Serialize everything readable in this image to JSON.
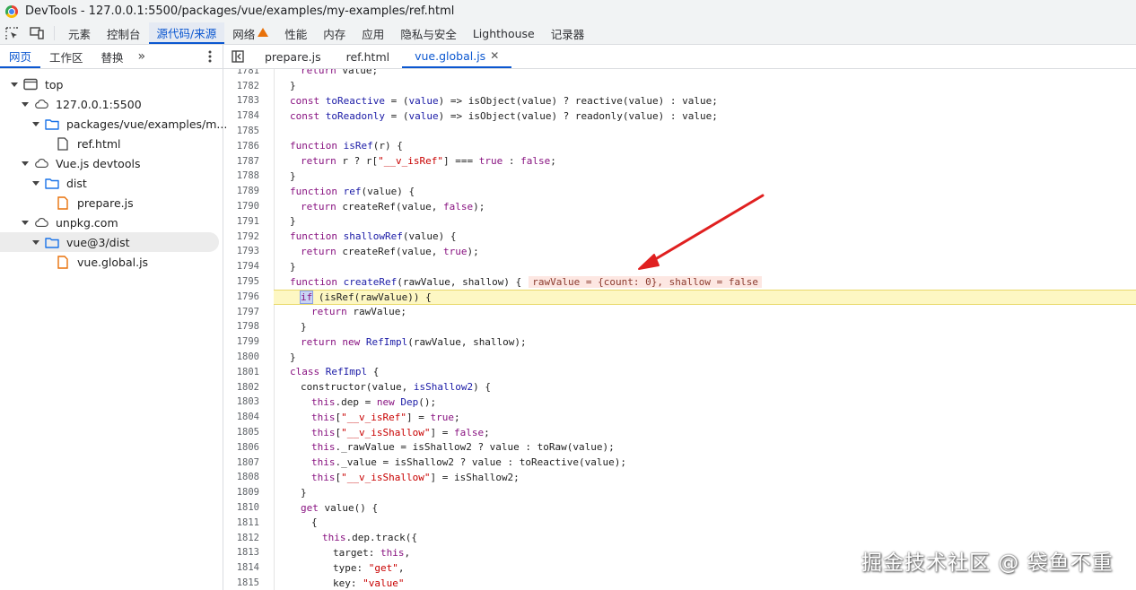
{
  "window": {
    "title": "DevTools - 127.0.0.1:5500/packages/vue/examples/my-examples/ref.html"
  },
  "main_tabs": [
    {
      "label": "元素"
    },
    {
      "label": "控制台"
    },
    {
      "label": "源代码/来源",
      "active": true
    },
    {
      "label": "网络",
      "warning": true
    },
    {
      "label": "性能"
    },
    {
      "label": "内存"
    },
    {
      "label": "应用"
    },
    {
      "label": "隐私与安全"
    },
    {
      "label": "Lighthouse"
    },
    {
      "label": "记录器"
    }
  ],
  "sidebar": {
    "tabs": [
      {
        "label": "网页",
        "active": true
      },
      {
        "label": "工作区"
      },
      {
        "label": "替换"
      }
    ],
    "more": "»",
    "tree": [
      {
        "label": "top",
        "icon": "frame-icon",
        "depth": 0,
        "caret": true
      },
      {
        "label": "127.0.0.1:5500",
        "icon": "cloud-icon",
        "depth": 1,
        "caret": true
      },
      {
        "label": "packages/vue/examples/m...",
        "icon": "folder-icon",
        "depth": 2,
        "caret": true
      },
      {
        "label": "ref.html",
        "icon": "file-icon",
        "depth": 3,
        "caret": false
      },
      {
        "label": "Vue.js devtools",
        "icon": "cloud-icon",
        "depth": 1,
        "caret": true
      },
      {
        "label": "dist",
        "icon": "folder-icon",
        "depth": 2,
        "caret": true
      },
      {
        "label": "prepare.js",
        "icon": "js-file-icon",
        "depth": 3,
        "caret": false
      },
      {
        "label": "unpkg.com",
        "icon": "cloud-icon",
        "depth": 1,
        "caret": true
      },
      {
        "label": "vue@3/dist",
        "icon": "folder-icon",
        "depth": 2,
        "caret": true,
        "selected": true
      },
      {
        "label": "vue.global.js",
        "icon": "js-file-icon",
        "depth": 3,
        "caret": false
      }
    ]
  },
  "editor": {
    "tabs": [
      {
        "label": "prepare.js"
      },
      {
        "label": "ref.html"
      },
      {
        "label": "vue.global.js",
        "active": true,
        "closable": true
      }
    ],
    "highlight_line": 1796,
    "lines": [
      {
        "n": "1781",
        "indent": 1,
        "html": "<span class='tk-kw'>return</span> value;"
      },
      {
        "n": "1782",
        "indent": 0,
        "html": "}"
      },
      {
        "n": "1783",
        "indent": 0,
        "html": "<span class='tk-kw'>const</span> <span class='tk-fn'>toReactive</span> = (<span class='tk-fn'>value</span>) => isObject(value) ? reactive(value) : value;"
      },
      {
        "n": "1784",
        "indent": 0,
        "html": "<span class='tk-kw'>const</span> <span class='tk-fn'>toReadonly</span> = (<span class='tk-fn'>value</span>) => isObject(value) ? readonly(value) : value;"
      },
      {
        "n": "1785",
        "indent": 0,
        "html": ""
      },
      {
        "n": "1786",
        "indent": 0,
        "html": "<span class='tk-kw'>function</span> <span class='tk-fn'>isRef</span>(r) {"
      },
      {
        "n": "1787",
        "indent": 1,
        "html": "<span class='tk-kw'>return</span> r ? r[<span class='tk-str'>\"__v_isRef\"</span>] === <span class='tk-kw'>true</span> : <span class='tk-kw'>false</span>;"
      },
      {
        "n": "1788",
        "indent": 0,
        "html": "}"
      },
      {
        "n": "1789",
        "indent": 0,
        "html": "<span class='tk-kw'>function</span> <span class='tk-fn'>ref</span>(value) {"
      },
      {
        "n": "1790",
        "indent": 1,
        "html": "<span class='tk-kw'>return</span> createRef(value, <span class='tk-kw'>false</span>);"
      },
      {
        "n": "1791",
        "indent": 0,
        "html": "}"
      },
      {
        "n": "1792",
        "indent": 0,
        "html": "<span class='tk-kw'>function</span> <span class='tk-fn'>shallowRef</span>(value) {"
      },
      {
        "n": "1793",
        "indent": 1,
        "html": "<span class='tk-kw'>return</span> createRef(value, <span class='tk-kw'>true</span>);"
      },
      {
        "n": "1794",
        "indent": 0,
        "html": "}"
      },
      {
        "n": "1795",
        "indent": 0,
        "html": "<span class='tk-kw'>function</span> <span class='tk-fn'>createRef</span>(rawValue, shallow) {<span class='inline-val'>rawValue = {count: 0}, shallow = false</span>"
      },
      {
        "n": "1796",
        "indent": 1,
        "html": "<span class='tk-kw ifmark'>if</span> (isRef(rawValue)) {"
      },
      {
        "n": "1797",
        "indent": 2,
        "html": "<span class='tk-kw'>return</span> rawValue;"
      },
      {
        "n": "1798",
        "indent": 1,
        "html": "}"
      },
      {
        "n": "1799",
        "indent": 1,
        "html": "<span class='tk-kw'>return new</span> <span class='tk-fn'>RefImpl</span>(rawValue, shallow);"
      },
      {
        "n": "1800",
        "indent": 0,
        "html": "}"
      },
      {
        "n": "1801",
        "indent": 0,
        "html": "<span class='tk-kw'>class</span> <span class='tk-fn'>RefImpl</span> {"
      },
      {
        "n": "1802",
        "indent": 1,
        "html": "constructor(value, <span class='tk-fn'>isShallow2</span>) {"
      },
      {
        "n": "1803",
        "indent": 2,
        "html": "<span class='tk-kw'>this</span>.dep = <span class='tk-kw'>new</span> <span class='tk-fn'>Dep</span>();"
      },
      {
        "n": "1804",
        "indent": 2,
        "html": "<span class='tk-kw'>this</span>[<span class='tk-str'>\"__v_isRef\"</span>] = <span class='tk-kw'>true</span>;"
      },
      {
        "n": "1805",
        "indent": 2,
        "html": "<span class='tk-kw'>this</span>[<span class='tk-str'>\"__v_isShallow\"</span>] = <span class='tk-kw'>false</span>;"
      },
      {
        "n": "1806",
        "indent": 2,
        "html": "<span class='tk-kw'>this</span>._rawValue = isShallow2 ? value : toRaw(value);"
      },
      {
        "n": "1807",
        "indent": 2,
        "html": "<span class='tk-kw'>this</span>._value = isShallow2 ? value : toReactive(value);"
      },
      {
        "n": "1808",
        "indent": 2,
        "html": "<span class='tk-kw'>this</span>[<span class='tk-str'>\"__v_isShallow\"</span>] = isShallow2;"
      },
      {
        "n": "1809",
        "indent": 1,
        "html": "}"
      },
      {
        "n": "1810",
        "indent": 1,
        "html": "<span class='tk-kw'>get</span> value() {"
      },
      {
        "n": "1811",
        "indent": 2,
        "html": "{"
      },
      {
        "n": "1812",
        "indent": 3,
        "html": "<span class='tk-kw'>this</span>.dep.track({"
      },
      {
        "n": "1813",
        "indent": 4,
        "html": "target: <span class='tk-kw'>this</span>,"
      },
      {
        "n": "1814",
        "indent": 4,
        "html": "type: <span class='tk-str'>\"get\"</span>,"
      },
      {
        "n": "1815",
        "indent": 4,
        "html": "key: <span class='tk-str'>\"value\"</span>"
      }
    ]
  },
  "watermark": "掘金技术社区 @ 袋鱼不重",
  "colors": {
    "accent": "#0b57d0",
    "highlight": "#fdf7c3",
    "arrow": "#e02020",
    "keyword": "#881280",
    "string": "#c80000"
  }
}
